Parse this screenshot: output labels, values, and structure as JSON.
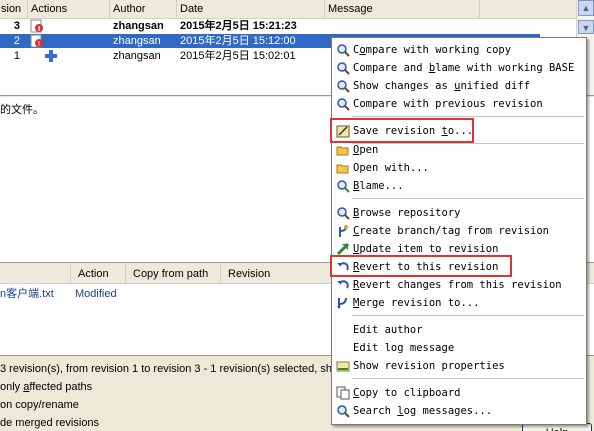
{
  "revision_list": {
    "columns": [
      "sion",
      "Actions",
      "Author",
      "Date",
      "Message"
    ],
    "rows": [
      {
        "revision": "3",
        "author": "zhangsan",
        "date": "2015年2月5日 15:21:23",
        "message": "",
        "bold": true,
        "selected": false
      },
      {
        "revision": "2",
        "author": "zhangsan",
        "date": "2015年2月5日 15:12:00",
        "message": "",
        "bold": false,
        "selected": true
      },
      {
        "revision": "1",
        "author": "zhangsan",
        "date": "2015年2月5日 15:02:01",
        "message": "",
        "bold": false,
        "selected": false
      }
    ]
  },
  "message_pane": {
    "text": "的文件。"
  },
  "changed_paths": {
    "columns": [
      "Action",
      "Copy from path",
      "Revision"
    ],
    "rows": [
      {
        "path": "n客户端.txt",
        "action": "Modified"
      }
    ]
  },
  "status": {
    "text": "3 revision(s), from revision 1 to revision 3 - 1 revision(s) selected, sh"
  },
  "options": [
    {
      "pre": "only ",
      "ul": "a",
      "post": "ffected paths"
    },
    {
      "pre": "on copy/rename",
      "ul": "",
      "post": ""
    },
    {
      "pre": "de merged revisions",
      "ul": "",
      "post": ""
    }
  ],
  "help_button": {
    "label": "Help"
  },
  "context_menu": {
    "items": [
      {
        "pre": "C",
        "ul": "o",
        "post": "mpare with working copy",
        "icon": "magnifier-compare-icon"
      },
      {
        "pre": "Compare and ",
        "ul": "b",
        "post": "lame with working BASE",
        "icon": "magnifier-compare-icon"
      },
      {
        "pre": "Show changes as ",
        "ul": "u",
        "post": "nified diff",
        "icon": "magnifier-compare-icon"
      },
      {
        "pre": "Compare with previous revision",
        "ul": "",
        "post": "",
        "icon": "magnifier-compare-icon"
      },
      {
        "pre": "Save revision ",
        "ul": "t",
        "post": "o...",
        "icon": "save-revision-icon",
        "highlight": true
      },
      {
        "pre": "",
        "ul": "O",
        "post": "pen",
        "icon": "open-folder-icon"
      },
      {
        "pre": "Open with...",
        "ul": "",
        "post": "",
        "icon": "open-folder-icon"
      },
      {
        "pre": "",
        "ul": "B",
        "post": "lame...",
        "icon": "blame-icon"
      },
      {
        "pre": "",
        "ul": "B",
        "post": "rowse repository",
        "icon": "browse-repo-icon"
      },
      {
        "pre": "",
        "ul": "C",
        "post": "reate branch/tag from revision",
        "icon": "branch-icon"
      },
      {
        "pre": "",
        "ul": "U",
        "post": "pdate item to revision",
        "icon": "update-icon"
      },
      {
        "pre": "",
        "ul": "R",
        "post": "evert to this revision",
        "icon": "revert-icon",
        "highlight": true
      },
      {
        "pre": "",
        "ul": "R",
        "post": "evert changes from this revision",
        "icon": "revert-icon"
      },
      {
        "pre": "",
        "ul": "M",
        "post": "erge revision to...",
        "icon": "merge-icon"
      },
      {
        "pre": "Edit author",
        "ul": "",
        "post": "",
        "icon": ""
      },
      {
        "pre": "Edit log message",
        "ul": "",
        "post": "",
        "icon": ""
      },
      {
        "pre": "Show revision properties",
        "ul": "",
        "post": "",
        "icon": "properties-icon"
      },
      {
        "pre": "",
        "ul": "C",
        "post": "opy to clipboard",
        "icon": "copy-icon"
      },
      {
        "pre": "Search ",
        "ul": "l",
        "post": "og messages...",
        "icon": "search-icon"
      }
    ]
  },
  "colors": {
    "selection": "#316ac5",
    "highlight_box": "#e03333",
    "link_text": "#1f3e8c"
  }
}
